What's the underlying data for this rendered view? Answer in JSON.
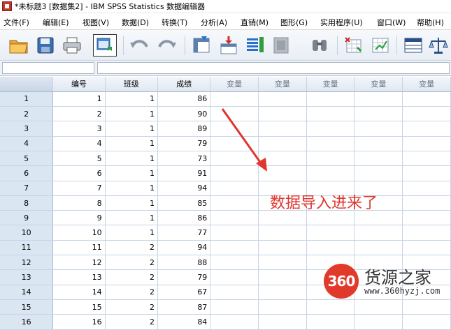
{
  "window": {
    "title": "*未标题3 [数据集2] - IBM SPSS Statistics 数据编辑器"
  },
  "menu": [
    {
      "label": "文件(F)"
    },
    {
      "label": "编辑(E)"
    },
    {
      "label": "视图(V)"
    },
    {
      "label": "数据(D)"
    },
    {
      "label": "转换(T)"
    },
    {
      "label": "分析(A)"
    },
    {
      "label": "直销(M)"
    },
    {
      "label": "图形(G)"
    },
    {
      "label": "实用程序(U)"
    },
    {
      "label": "窗口(W)"
    },
    {
      "label": "帮助(H)"
    }
  ],
  "toolbar": [
    {
      "icon": "open-folder-icon"
    },
    {
      "icon": "save-disk-icon"
    },
    {
      "icon": "print-icon"
    },
    {
      "icon": "recall-dialog-icon"
    },
    {
      "icon": "undo-icon"
    },
    {
      "icon": "redo-icon"
    },
    {
      "icon": "goto-case-icon"
    },
    {
      "icon": "goto-variable-icon"
    },
    {
      "icon": "variables-icon"
    },
    {
      "icon": "run-descriptives-icon"
    },
    {
      "icon": "find-icon"
    },
    {
      "icon": "insert-cases-icon"
    },
    {
      "icon": "insert-variable-icon"
    },
    {
      "icon": "split-file-icon"
    },
    {
      "icon": "weight-cases-icon"
    }
  ],
  "grid": {
    "columns": [
      "编号",
      "班级",
      "成绩",
      "变量",
      "变量",
      "变量",
      "变量",
      "变量"
    ],
    "rows": [
      {
        "n": "1",
        "id": "1",
        "class": "1",
        "score": "86"
      },
      {
        "n": "2",
        "id": "2",
        "class": "1",
        "score": "90"
      },
      {
        "n": "3",
        "id": "3",
        "class": "1",
        "score": "89"
      },
      {
        "n": "4",
        "id": "4",
        "class": "1",
        "score": "79"
      },
      {
        "n": "5",
        "id": "5",
        "class": "1",
        "score": "73"
      },
      {
        "n": "6",
        "id": "6",
        "class": "1",
        "score": "91"
      },
      {
        "n": "7",
        "id": "7",
        "class": "1",
        "score": "94"
      },
      {
        "n": "8",
        "id": "8",
        "class": "1",
        "score": "85"
      },
      {
        "n": "9",
        "id": "9",
        "class": "1",
        "score": "86"
      },
      {
        "n": "10",
        "id": "10",
        "class": "1",
        "score": "77"
      },
      {
        "n": "11",
        "id": "11",
        "class": "2",
        "score": "94"
      },
      {
        "n": "12",
        "id": "12",
        "class": "2",
        "score": "88"
      },
      {
        "n": "13",
        "id": "13",
        "class": "2",
        "score": "79"
      },
      {
        "n": "14",
        "id": "14",
        "class": "2",
        "score": "67"
      },
      {
        "n": "15",
        "id": "15",
        "class": "2",
        "score": "87"
      },
      {
        "n": "16",
        "id": "16",
        "class": "2",
        "score": "84"
      }
    ]
  },
  "annotation": {
    "text": "数据导入进来了",
    "color": "#e0362e"
  },
  "watermark": {
    "badge": "360",
    "name": "货源之家",
    "url": "www.360hyzj.com"
  }
}
